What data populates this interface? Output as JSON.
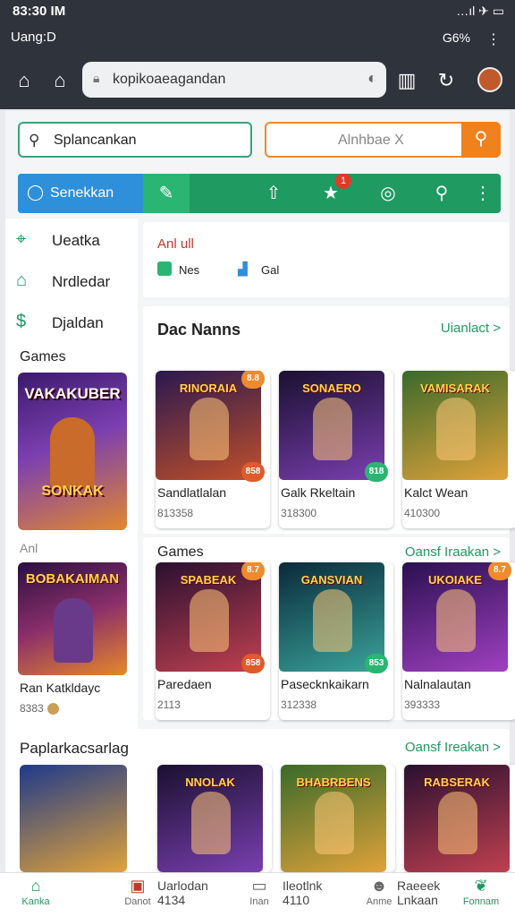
{
  "status": {
    "time": "83:30 IM",
    "account": "Uang:D",
    "signal": "…ıl ✈ ▭",
    "battery": "G6%"
  },
  "browser": {
    "url": "kopikoaeagandan"
  },
  "search": {
    "placeholder": "Splancankan"
  },
  "alt_search": {
    "text": "Alnhbae X"
  },
  "tabs": {
    "first": "Senekkan",
    "badge": "1"
  },
  "sidebar": {
    "items": [
      {
        "label": "Ueatka",
        "icon": "map-icon"
      },
      {
        "label": "Nrdledar",
        "icon": "home-icon"
      },
      {
        "label": "Djaldan",
        "icon": "dollar-icon"
      }
    ],
    "games_header": "Games",
    "card1": {
      "title": "VAKAKUBER",
      "subtitle": "SONKAK"
    },
    "ani_label": "Anl",
    "card2": {
      "title": "BOBAKAIMAN",
      "name": "Ran Katkldayc",
      "num": "8383"
    }
  },
  "info": {
    "red": "Anl ull",
    "a": "Nes",
    "b": "Gal"
  },
  "section1": {
    "title": "Dac Nanns",
    "link": "Uianlact >",
    "cards": [
      {
        "art": "RINORAIA",
        "name": "Sandlatlalan",
        "num": "813358",
        "price_top": "8.8",
        "price_bot": "858"
      },
      {
        "art": "SONAERO",
        "name": "Galk Rkeltain",
        "num": "318300",
        "price_top": "",
        "price_bot": "818"
      },
      {
        "art": "VAMISARAK",
        "name": "Kalct Wean",
        "num": "410300",
        "price_top": "",
        "price_bot": ""
      }
    ]
  },
  "section2": {
    "title": "Games",
    "link": "Oansf Iraakan >",
    "cards": [
      {
        "art": "SPABEAK",
        "name": "Paredaen",
        "num": "2113",
        "price_top": "8.7",
        "price_bot": "858"
      },
      {
        "art": "GANSVIAN",
        "name": "Pasecknkaikarn",
        "num": "312338",
        "price_top": "",
        "price_bot": "853"
      },
      {
        "art": "UKOIAKE",
        "name": "Nalnalautan",
        "num": "393333",
        "price_top": "8.7",
        "price_bot": ""
      }
    ]
  },
  "section3": {
    "title": "Paplarkacsarlag",
    "link": "Oansf Ireakan >",
    "cards": [
      {
        "art": "NNOLAK"
      },
      {
        "art": "BHABRBENS"
      },
      {
        "art": "RABSERAK"
      }
    ]
  },
  "bottom": [
    {
      "label": "Kanka",
      "icon": "home-icon"
    },
    {
      "label": "Danot",
      "icon": "grid-icon"
    },
    {
      "label": "Uarlodan 4134",
      "icon": ""
    },
    {
      "label": "Inan",
      "icon": "tablet-icon"
    },
    {
      "label": "Ileotlnk 4110",
      "icon": ""
    },
    {
      "label": "Anme",
      "icon": "person-icon"
    },
    {
      "label": "Raeeek Lnkaan",
      "icon": ""
    },
    {
      "label": "Fonnam",
      "icon": "leaf-icon"
    }
  ],
  "colors": {
    "accent": "#1f9a60",
    "blue": "#2e8fdb",
    "orange": "#f0821e",
    "badge": "#e03a2a"
  }
}
